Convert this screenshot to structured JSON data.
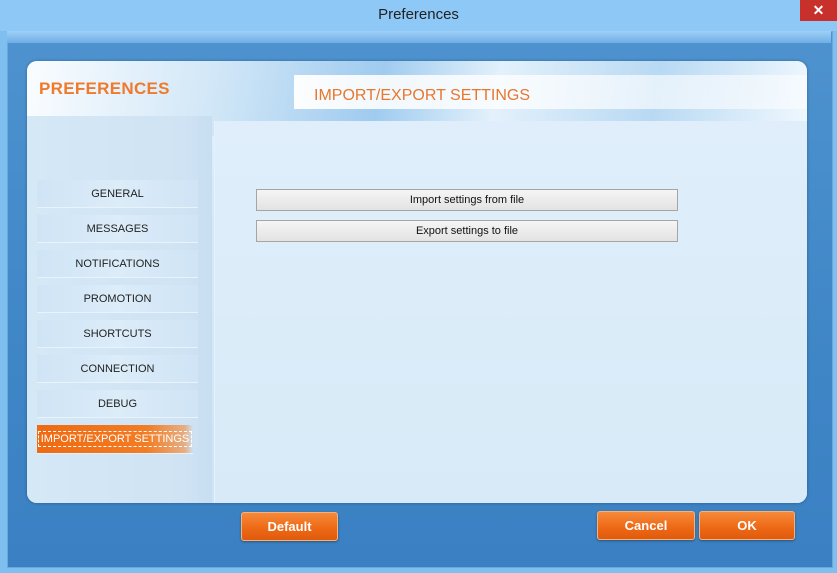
{
  "window": {
    "title": "Preferences",
    "close_label": "✕"
  },
  "header": {
    "app_title": "PREFERENCES",
    "section_title": "IMPORT/EXPORT SETTINGS"
  },
  "sidebar": {
    "items": [
      {
        "label": "GENERAL"
      },
      {
        "label": "MESSAGES"
      },
      {
        "label": "NOTIFICATIONS"
      },
      {
        "label": "PROMOTION"
      },
      {
        "label": "SHORTCUTS"
      },
      {
        "label": "CONNECTION"
      },
      {
        "label": "DEBUG"
      },
      {
        "label": "IMPORT/EXPORT SETTINGS",
        "active": true
      }
    ]
  },
  "content": {
    "import_label": "Import settings from file",
    "export_label": "Export settings to file"
  },
  "footer": {
    "default_label": "Default",
    "cancel_label": "Cancel",
    "ok_label": "OK"
  },
  "colors": {
    "accent": "#f07a2c",
    "active_nav": "#ef6a12"
  }
}
